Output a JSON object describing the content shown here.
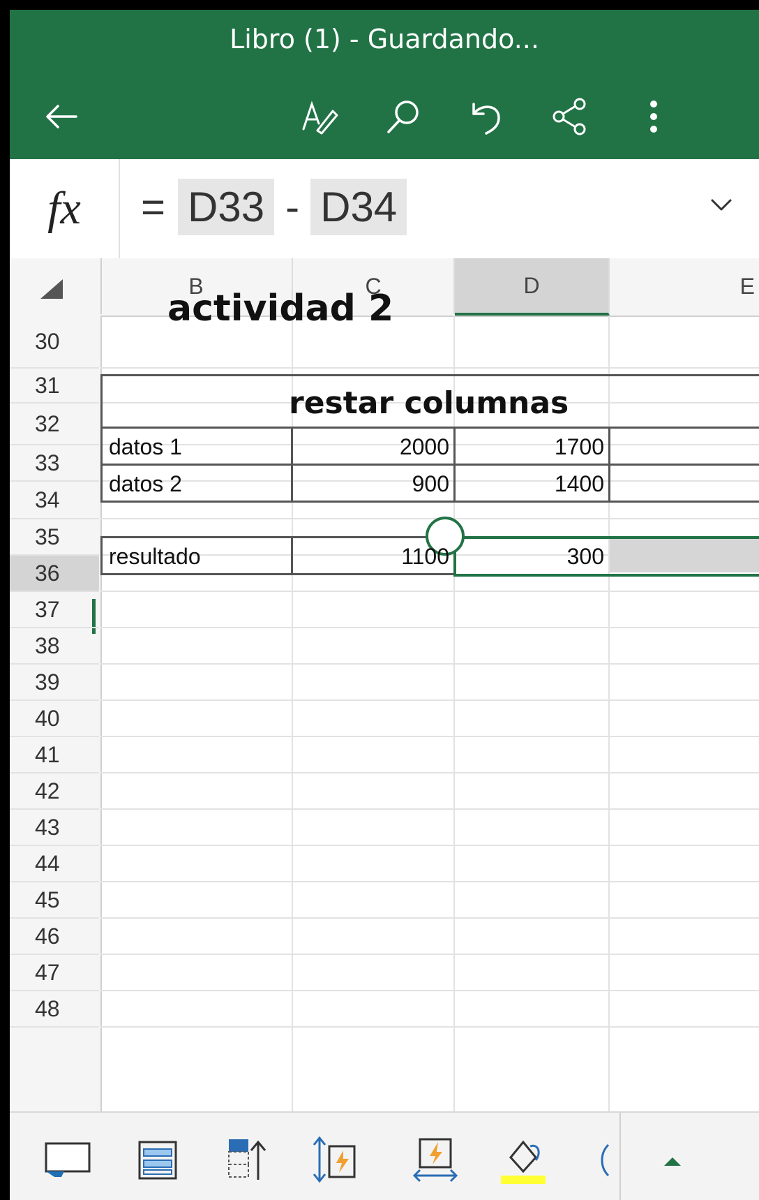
{
  "header": {
    "title": "Libro (1) - Guardando...",
    "icons": [
      "back-arrow-icon",
      "text-edit-icon",
      "search-icon",
      "undo-icon",
      "share-icon",
      "more-icon"
    ]
  },
  "formula_bar": {
    "fx_label": "fx",
    "equals": "=",
    "ref1": "D33",
    "operator": "-",
    "ref2": "D34"
  },
  "grid": {
    "columns": [
      "B",
      "C",
      "D",
      "E"
    ],
    "selected_column": "D",
    "rows": [
      "30",
      "31",
      "32",
      "33",
      "34",
      "35",
      "36",
      "37",
      "38",
      "39",
      "40",
      "41",
      "42",
      "43",
      "44",
      "45",
      "46",
      "47",
      "48"
    ],
    "selected_row": "36",
    "cells": {
      "title": "actividad 2",
      "table_heading": "restar columnas",
      "r33_label": "datos 1",
      "r33_c": "2000",
      "r33_d": "1700",
      "r34_label": "datos 2",
      "r34_c": "900",
      "r34_d": "1400",
      "r36_label": "resultado",
      "r36_c": "1100",
      "r36_d": "300"
    }
  },
  "toolbar": {
    "icons": [
      "screen-icon",
      "table-icon",
      "insert-row-icon",
      "flash-fill-icon",
      "autofit-icon",
      "fill-color-icon",
      "partial-icon",
      "expand-up-icon"
    ],
    "fill_color": "#ffff33"
  },
  "colors": {
    "accent": "#217346"
  }
}
